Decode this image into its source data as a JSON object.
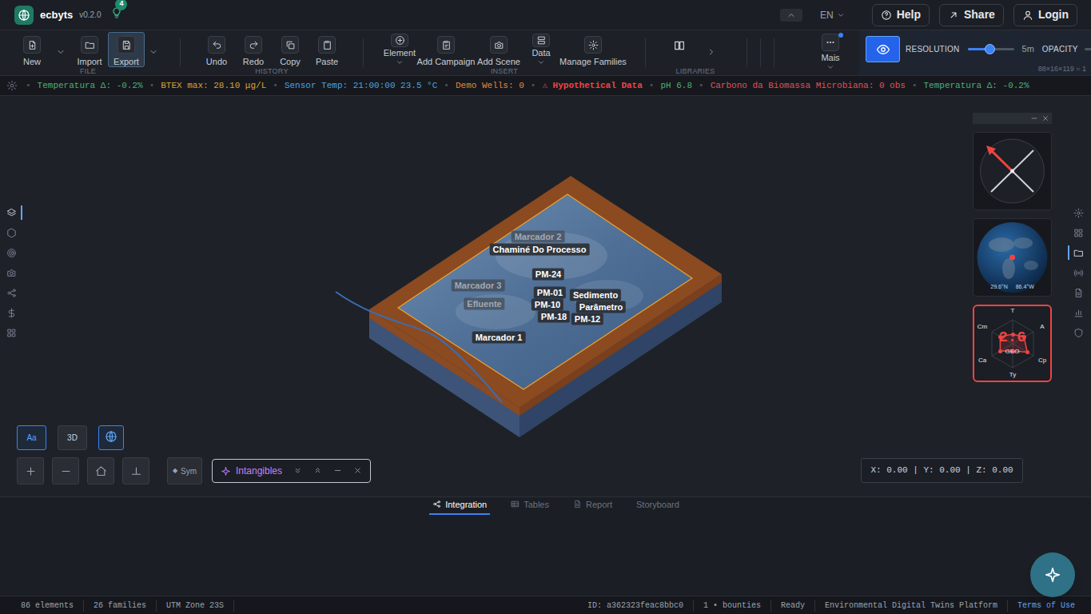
{
  "app": {
    "name": "ecbyts",
    "version": "v0.2.0",
    "badge": "4"
  },
  "topbar": {
    "language": "EN",
    "buttons": [
      "Help",
      "Share",
      "Login"
    ]
  },
  "toolbar": {
    "groups": [
      {
        "label": "FILE",
        "items": [
          {
            "kind": "button",
            "label": "New",
            "selected": false
          },
          {
            "kind": "arrow",
            "selected": false
          },
          {
            "kind": "button",
            "label": "Import",
            "selected": false
          },
          {
            "kind": "button",
            "label": "Export",
            "selected": true
          },
          {
            "kind": "arrow",
            "selected": false
          }
        ]
      },
      {
        "label": "HISTORY",
        "items": [
          {
            "kind": "button",
            "label": "Undo",
            "selected": false
          },
          {
            "kind": "button",
            "label": "Redo",
            "selected": false
          },
          {
            "kind": "button",
            "label": "Copy",
            "selected": false
          },
          {
            "kind": "button",
            "label": "Paste",
            "selected": false
          }
        ]
      },
      {
        "label": "INSERT",
        "items": [
          {
            "kind": "menu",
            "label": "Element",
            "selected": false
          },
          {
            "kind": "button",
            "label": "Add Campaign",
            "selected": false
          },
          {
            "kind": "button",
            "label": "Add Scene",
            "selected": false
          },
          {
            "kind": "menu",
            "label": "Data",
            "selected": false
          },
          {
            "kind": "button",
            "label": "Manage Families",
            "selected": false
          }
        ]
      },
      {
        "label": "LIBRARIES",
        "items": [
          {
            "kind": "icon",
            "selected": false
          },
          {
            "kind": "arrow",
            "selected": false
          }
        ]
      }
    ],
    "more": {
      "label": "Mais",
      "notify": true
    }
  },
  "view": {
    "eye_on": true,
    "resolution": {
      "label": "RESOLUTION",
      "level": 0.48,
      "reading": "5m"
    },
    "opacity": {
      "label": "OPACITY"
    },
    "grid": "88×16×119 = 1"
  },
  "ticker": {
    "separator": "•",
    "items": [
      {
        "text": "Temperatura Δ: -0.2%",
        "kind": "metric",
        "color": "#4caf7a"
      },
      {
        "text": "BTEX max: 28.10 μg/L",
        "kind": "metric",
        "color": "#d9a23a"
      },
      {
        "text": "Sensor Temp: 21:00:00 23.5 °C",
        "kind": "metric",
        "color": "#4aa3df"
      },
      {
        "text": "Demo Wells: 0",
        "kind": "metric",
        "color": "#e0873a"
      },
      {
        "text": "⚠ Hypothetical Data",
        "kind": "alert",
        "color": "#ef4444"
      },
      {
        "text": "pH 6.8",
        "kind": "metric",
        "color": "#4caf7a"
      },
      {
        "text": "Carbono da Biomassa Microbiana: 0 obs",
        "kind": "metric",
        "color": "#e0505a"
      },
      {
        "text": "Temperatura Δ: -0.2%",
        "kind": "metric",
        "color": "#4caf7a"
      }
    ]
  },
  "scene": {
    "labels": [
      {
        "text": "Marcador 2",
        "faded": true
      },
      {
        "text": "Chaminé Do Processo",
        "faded": false
      },
      {
        "text": "PM-24",
        "faded": false
      },
      {
        "text": "Marcador 3",
        "faded": true
      },
      {
        "text": "PM-01",
        "faded": false
      },
      {
        "text": "Sedimento",
        "faded": false
      },
      {
        "text": "Efluente",
        "faded": true
      },
      {
        "text": "PM-10",
        "faded": false
      },
      {
        "text": "Parâmetro",
        "faded": false
      },
      {
        "text": "PM-18",
        "faded": false
      },
      {
        "text": "PM-12",
        "faded": false
      },
      {
        "text": "Marcador 1",
        "faded": false
      }
    ]
  },
  "left_sidebar": {
    "items": [
      {
        "selected": true
      },
      {
        "selected": false
      },
      {
        "selected": false
      },
      {
        "selected": false
      },
      {
        "selected": false
      },
      {
        "selected": false
      },
      {
        "selected": false
      }
    ]
  },
  "right_sidebar": {
    "items": [
      {
        "selected": false
      },
      {
        "selected": false
      },
      {
        "selected": true
      },
      {
        "selected": false
      },
      {
        "selected": false
      },
      {
        "selected": false
      },
      {
        "selected": false
      }
    ]
  },
  "widgets": {
    "globe": {
      "lat": "29.6°N",
      "lon": "86.4°W"
    },
    "radar": {
      "value": "2.6",
      "center": "GEO",
      "axes": [
        "T",
        "A",
        "Cp",
        "Ty",
        "Ca",
        "Cm"
      ],
      "values": [
        0.4,
        0.55,
        0.7,
        0.3,
        0.6,
        0.6
      ]
    }
  },
  "controls": {
    "view_buttons": [
      {
        "kind": "text",
        "label": "Aa",
        "selected": true
      },
      {
        "kind": "text",
        "label": "3D",
        "selected": false
      },
      {
        "kind": "icon",
        "selected": true
      }
    ],
    "sym": {
      "icon": "◆",
      "label": "Sym"
    },
    "intangibles": {
      "label": "Intangibles"
    },
    "coords": "X: 0.00 | Y: 0.00 | Z: 0.00"
  },
  "tabs": [
    {
      "label": "Integration",
      "selected": true
    },
    {
      "label": "Tables",
      "selected": false
    },
    {
      "label": "Report",
      "selected": false
    },
    {
      "label": "Storyboard",
      "selected": false
    }
  ],
  "status_bar": {
    "left": [
      "86 elements",
      "26 families",
      "UTM Zone 23S"
    ],
    "right": [
      "ID: a362323feac8bbc0",
      "1 • bounties",
      "Ready",
      "Environmental Digital Twins Platform"
    ],
    "link": "Terms of Use"
  }
}
